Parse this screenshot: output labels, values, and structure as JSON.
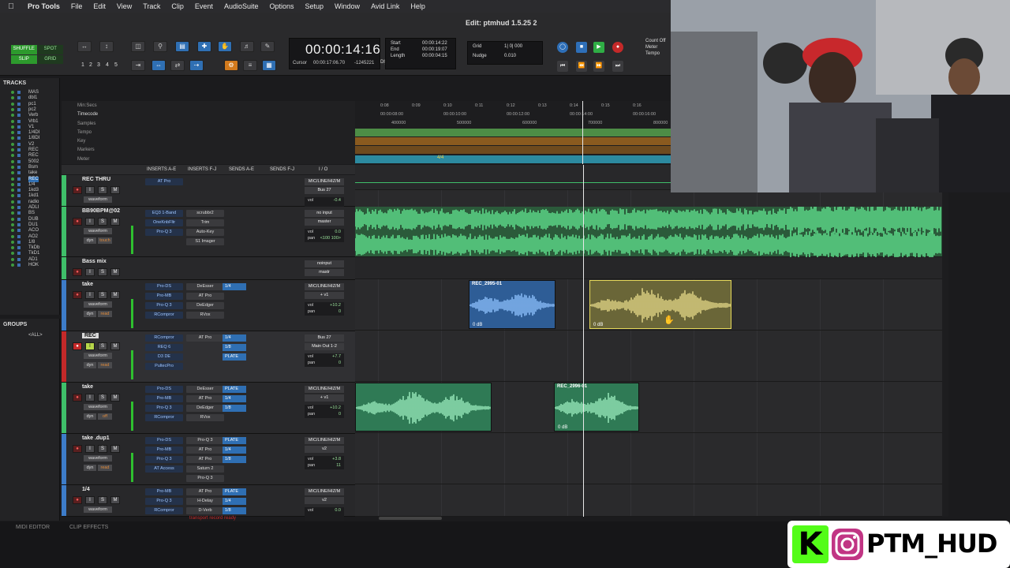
{
  "menubar": {
    "app": "Pro Tools",
    "items": [
      "File",
      "Edit",
      "View",
      "Track",
      "Clip",
      "Event",
      "AudioSuite",
      "Options",
      "Setup",
      "Window",
      "Avid Link",
      "Help"
    ]
  },
  "window": {
    "title": "Edit: ptmhud 1.5.25 2"
  },
  "edit_modes": {
    "shuffle": "SHUFFLE",
    "spot": "SPOT",
    "slip": "SLIP",
    "grid": "GRID"
  },
  "zoom_presets": [
    "1",
    "2",
    "3",
    "4",
    "5"
  ],
  "counter": {
    "main": "00:00:14:16",
    "cursor_label": "Cursor",
    "cursor_value": "00:00:17:06.70",
    "sample_value": "-1245221",
    "dly": "Dly",
    "start_label": "Start",
    "start_value": "00:00:14:22",
    "end_label": "End",
    "end_value": "00:00:19:07",
    "length_label": "Length",
    "length_value": "00:00:04:15"
  },
  "grid": {
    "grid_label": "Grid",
    "grid_value": "1| 0| 000",
    "nudge_label": "Nudge",
    "nudge_value": "0.010"
  },
  "countoff": {
    "line1": "Count Off",
    "line2": "Meter",
    "line3": "Tempo"
  },
  "tracks_panel": {
    "title": "TRACKS",
    "items": [
      "MAS",
      "dbl1",
      "pc1",
      "pc2",
      "Verb",
      "Vrb1",
      "V1",
      "1/4DI",
      "1/8DI",
      "V2",
      "REC",
      "REC",
      "5002",
      "Bsm",
      "take",
      "REC",
      "1/4",
      "1kd3",
      "1kd1",
      "radio",
      "ADLI",
      "BS",
      "DUB",
      "DU1",
      "ACO",
      "AO2",
      "1/8",
      "TkDb",
      "TkD1",
      "AD1",
      "HOK"
    ],
    "selected_index": 15
  },
  "groups_panel": {
    "title": "GROUPS",
    "item": "<ALL>"
  },
  "rulers": {
    "labels": [
      "Min:Secs",
      "Timecode",
      "Samples",
      "Tempo",
      "Key",
      "Markers",
      "Meter"
    ],
    "minsecs": [
      "0:08",
      "0:09",
      "0:10",
      "0:11",
      "0:12",
      "0:13",
      "0:14",
      "0:15",
      "0:16"
    ],
    "timecode": [
      "00:00:08:00",
      "00:00:10:00",
      "00:00:12:00",
      "00:00:14:00",
      "00:00:16:00"
    ],
    "samples": [
      "400000",
      "500000",
      "600000",
      "700000",
      "800000"
    ],
    "meter_value": "4/4"
  },
  "column_headers": [
    "INSERTS A-E",
    "INSERTS F-J",
    "SENDS A-E",
    "SENDS F-J",
    "I / O"
  ],
  "buttons": {
    "rec": "●",
    "input": "I",
    "solo": "S",
    "mute": "M",
    "view": "waveform",
    "dyn": "dyn"
  },
  "tracks": [
    {
      "name": "REC THRU",
      "inserts_a": [
        "AT Pro"
      ],
      "inserts_f": [],
      "sends": [],
      "io": [
        "MIC/LINE/HIZ/M",
        "Bus 27"
      ],
      "vol": "-0.4"
    },
    {
      "name": "BB90BPM@02",
      "inserts_a": [
        "EQ3 1-Band",
        "OneKnbFltr",
        "Pro-Q 3"
      ],
      "inserts_f": [
        "scrubbr2",
        "Trim",
        "Auto-Key",
        "S1 Imager"
      ],
      "sends": [],
      "io": [
        "no input",
        "master"
      ],
      "vol": "0.0",
      "pan": "<100 100>",
      "dyn_state": "touch"
    },
    {
      "name": "Bass mix",
      "inserts_a": [],
      "inserts_f": [],
      "sends": [],
      "io": [
        "noinput",
        "mastr"
      ],
      "vol": "",
      "view_state": "wave",
      "dyn_state": "touch"
    },
    {
      "name": "take",
      "inserts_a": [
        "Pro-DS",
        "Pro-MB",
        "Pro-Q 3",
        "RCompror"
      ],
      "inserts_f": [
        "DeEsser",
        "AT Pro",
        "DeEdger",
        "RVox"
      ],
      "sends": [
        "1/4"
      ],
      "io": [
        "MIC/LINE/HIZ/M",
        "+ v1"
      ],
      "vol": "+10.2",
      "pan": "0",
      "dyn_state": "read"
    },
    {
      "name": "REC",
      "inserts_a": [
        "RCompror",
        "REQ 6",
        "D3 DE",
        "PultecPro"
      ],
      "inserts_f": [
        "AT Pro"
      ],
      "sends": [
        "1/4",
        "1/8",
        "PLATE"
      ],
      "io": [
        "Bus 27",
        "Main Out 1-2"
      ],
      "vol": "+7.7",
      "pan": "0",
      "dyn_state": "read"
    },
    {
      "name": "take",
      "inserts_a": [
        "Pro-DS",
        "Pro-MB",
        "Pro-Q 3",
        "RCompror"
      ],
      "inserts_f": [
        "DeEsser",
        "AT Pro",
        "DeEdger",
        "RVox"
      ],
      "sends": [
        "PLATE",
        "1/4",
        "1/8"
      ],
      "io": [
        "MIC/LINE/HIZ/M",
        "+ v1"
      ],
      "vol": "+10.2",
      "pan": "0",
      "dyn_state": "off"
    },
    {
      "name": "take .dup1",
      "inserts_a": [
        "Pro-DS",
        "Pro-MB",
        "Pro-Q 3",
        "AT Access"
      ],
      "inserts_f": [
        "Pro-Q 3",
        "AT Pro",
        "AT Pro",
        "Saturn 2",
        "Pro-Q 3"
      ],
      "sends": [
        "PLATE",
        "1/4",
        "1/8"
      ],
      "io": [
        "MIC/LINE/HIZ/M",
        "v2"
      ],
      "vol": "+3.8",
      "pan": "11",
      "dyn_state": "read"
    },
    {
      "name": "1/4",
      "inserts_a": [
        "Pro-MB",
        "Pro-Q 3",
        "RCompror"
      ],
      "inserts_f": [
        "AT Pro",
        "H-Delay",
        "D-Verb"
      ],
      "sends": [
        "PLATE",
        "1/4",
        "1/8"
      ],
      "io": [
        "MIC/LINE/HIZ/M",
        "v2"
      ],
      "vol": "0.0"
    }
  ],
  "status_text": "transport record ready",
  "clips": [
    {
      "name": "REC_2995-01",
      "gain": "0 dB"
    },
    {
      "name": "",
      "gain": "0 dB"
    },
    {
      "name": "",
      "gain": ""
    },
    {
      "name": "REC_2996-01",
      "gain": "0 dB"
    }
  ],
  "bottom_tabs": [
    "MIDI EDITOR",
    "CLIP EFFECTS"
  ],
  "overlay": {
    "handle": "PTM_HUD",
    "kick_letter": "K"
  },
  "colors": {
    "audio_green": "#3fbf6a",
    "clip_blue": "#3d7cc9",
    "clip_yellow": "#c9b94a",
    "accent_blue": "#2f6fb3",
    "rec_red": "#c42929",
    "kick_green": "#53fc18"
  }
}
